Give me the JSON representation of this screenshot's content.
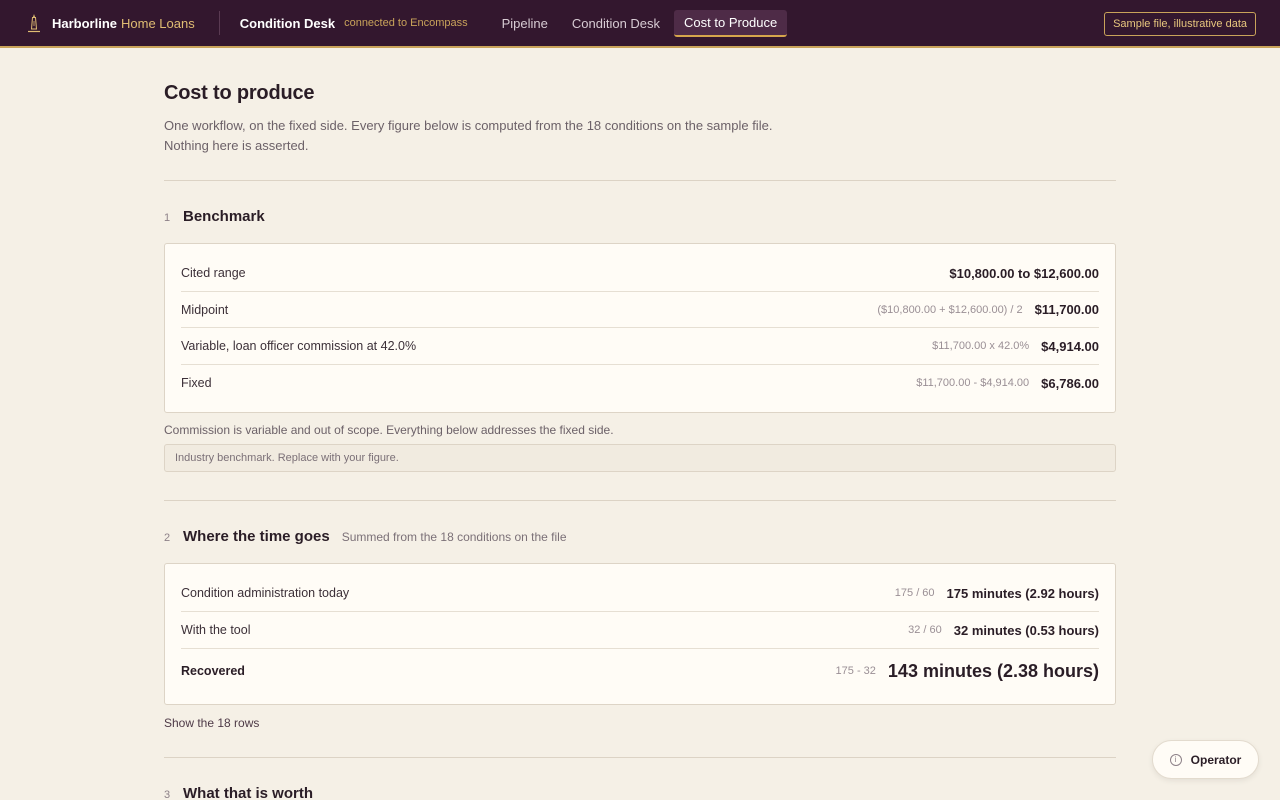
{
  "brand": {
    "name": "Harborline",
    "sub": "Home Loans"
  },
  "app": {
    "title": "Condition Desk",
    "status": "connected to Encompass"
  },
  "nav": {
    "items": [
      {
        "label": "Pipeline"
      },
      {
        "label": "Condition Desk"
      },
      {
        "label": "Cost to Produce"
      }
    ],
    "active": "Cost to Produce"
  },
  "badge": "Sample file, illustrative data",
  "page": {
    "title": "Cost to produce",
    "lede_1": "One workflow, on the fixed side. Every figure below is computed from the 18 conditions on the sample file.",
    "lede_2": "Nothing here is asserted."
  },
  "s1": {
    "num": "1",
    "title": "Benchmark",
    "rows": [
      {
        "label": "Cited range",
        "calc": "",
        "value": "$10,800.00 to $12,600.00"
      },
      {
        "label": "Midpoint",
        "calc": "($10,800.00 + $12,600.00) / 2",
        "value": "$11,700.00"
      },
      {
        "label": "Variable, loan officer commission at 42.0%",
        "calc": "$11,700.00 x 42.0%",
        "value": "$4,914.00"
      },
      {
        "label": "Fixed",
        "calc": "$11,700.00 - $4,914.00",
        "value": "$6,786.00"
      }
    ],
    "note": "Commission is variable and out of scope. Everything below addresses the fixed side.",
    "input_note": "Industry benchmark. Replace with your figure."
  },
  "s2": {
    "num": "2",
    "title": "Where the time goes",
    "sub": "Summed from the 18 conditions on the file",
    "rows": [
      {
        "label": "Condition administration today",
        "calc": "175 / 60",
        "value": "175 minutes (2.92 hours)"
      },
      {
        "label": "With the tool",
        "calc": "32 / 60",
        "value": "32 minutes (0.53 hours)"
      },
      {
        "label": "Recovered",
        "calc": "175 - 32",
        "value": "143 minutes (2.38 hours)"
      }
    ],
    "toggle": "Show the 18 rows"
  },
  "s3": {
    "num": "3",
    "title": "What that is worth"
  },
  "operator": {
    "label": "Operator",
    "icon": "info-icon"
  }
}
